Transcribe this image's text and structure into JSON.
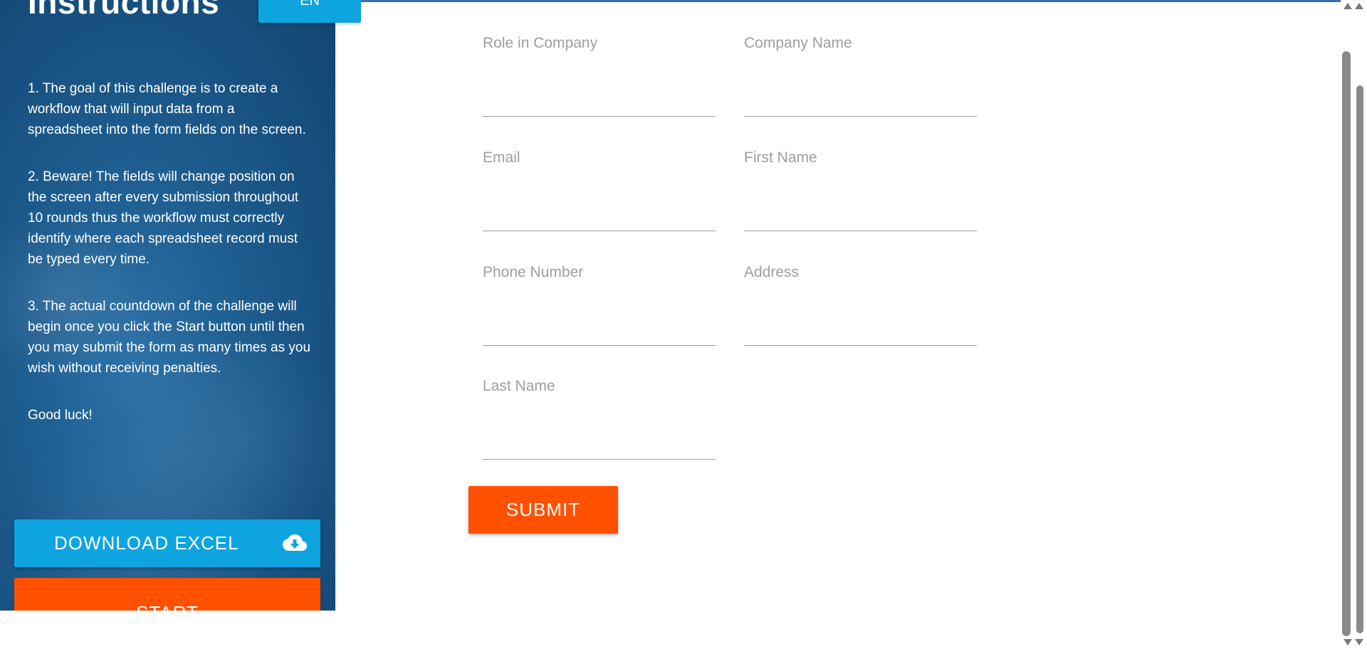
{
  "sidebar": {
    "title": "Instructions",
    "language_button": "EN",
    "instructions": [
      "1. The goal of this challenge is to create a workflow that will input data from a spreadsheet into the form fields on the screen.",
      "2. Beware! The fields will change position on the screen after every submission throughout 10 rounds thus the workflow must correctly identify where each spreadsheet record must be typed every time.",
      "3. The actual countdown of the challenge will begin once you click the Start button until then you may submit the form as many times as you wish without receiving penalties.",
      "Good luck!"
    ],
    "download_button": "DOWNLOAD EXCEL",
    "download_icon": "cloud-download-icon",
    "start_button": "START"
  },
  "form": {
    "fields": [
      {
        "label": "Role in Company",
        "value": ""
      },
      {
        "label": "Company Name",
        "value": ""
      },
      {
        "label": "Email",
        "value": ""
      },
      {
        "label": "First Name",
        "value": ""
      },
      {
        "label": "Phone Number",
        "value": ""
      },
      {
        "label": "Address",
        "value": ""
      },
      {
        "label": "Last Name",
        "value": ""
      }
    ],
    "submit_button": "SUBMIT"
  },
  "colors": {
    "sidebar_bg": "#1f5f92",
    "accent_blue": "#0ea4df",
    "accent_orange": "#ff5100",
    "label_gray": "#9e9e9e"
  }
}
